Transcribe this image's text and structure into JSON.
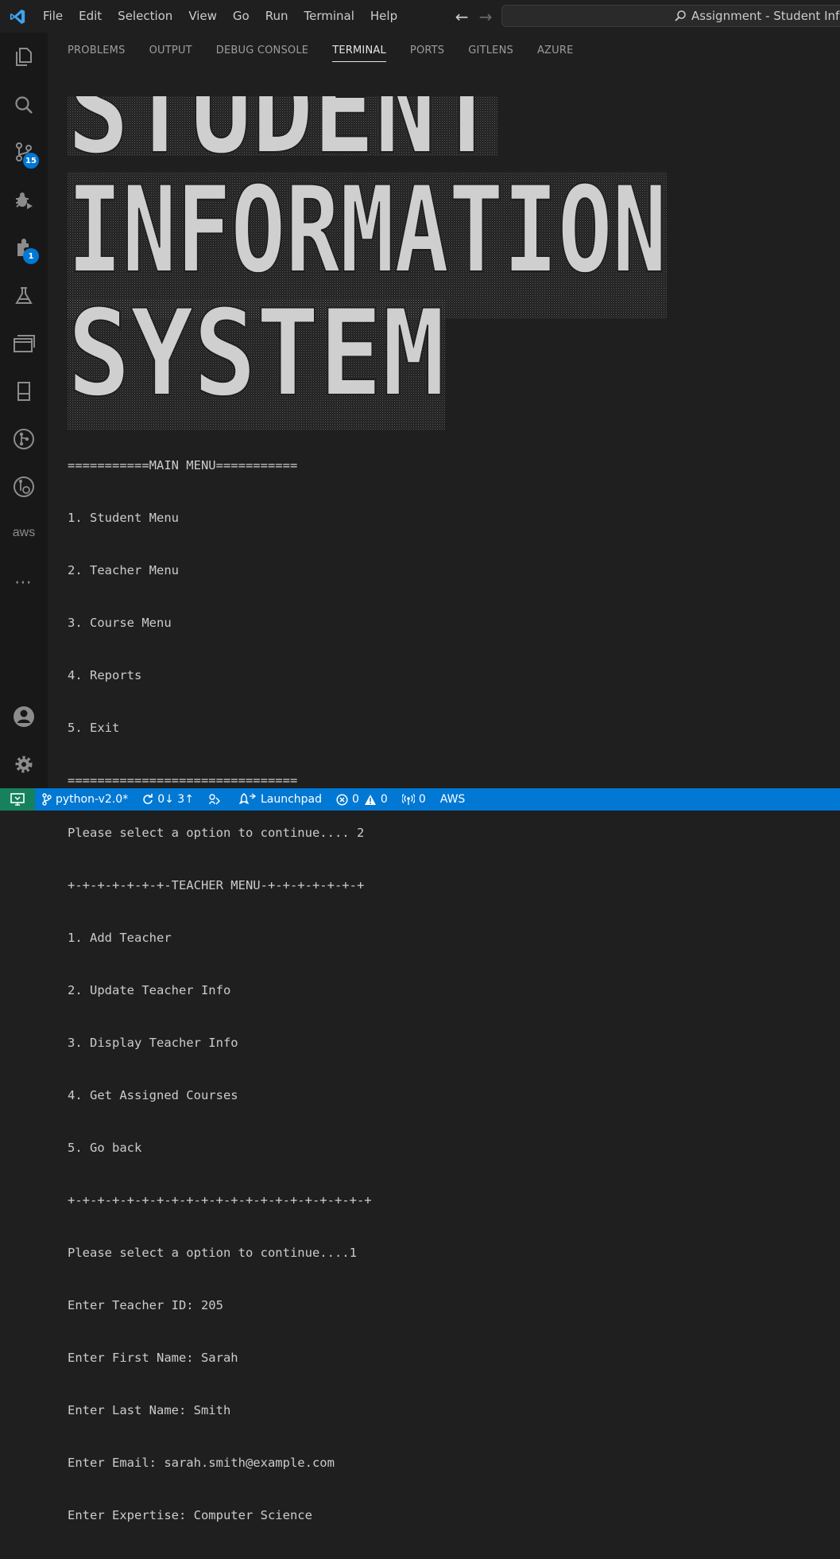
{
  "menu": [
    "File",
    "Edit",
    "Selection",
    "View",
    "Go",
    "Run",
    "Terminal",
    "Help"
  ],
  "search": {
    "text": "Assignment - Student Information System"
  },
  "activity": {
    "scm_badge": "15",
    "extensions_badge": "1",
    "aws_label": "aws"
  },
  "panel": {
    "tabs": [
      "PROBLEMS",
      "OUTPUT",
      "DEBUG CONSOLE",
      "TERMINAL",
      "PORTS",
      "GITLENS",
      "AZURE"
    ],
    "active_tab": "TERMINAL"
  },
  "banner": {
    "lines": [
      "STUDENT",
      "INFORMATION",
      "SYSTEM"
    ]
  },
  "terminal": {
    "lines": [
      "===========MAIN MENU===========",
      "1. Student Menu",
      "2. Teacher Menu",
      "3. Course Menu",
      "4. Reports",
      "5. Exit",
      "===============================",
      "Please select a option to continue.... 2",
      "+-+-+-+-+-+-+-TEACHER MENU-+-+-+-+-+-+-+",
      "1. Add Teacher",
      "2. Update Teacher Info",
      "3. Display Teacher Info",
      "4. Get Assigned Courses",
      "5. Go back",
      "+-+-+-+-+-+-+-+-+-+-+-+-+-+-+-+-+-+-+-+-+",
      "Please select a option to continue....1",
      "Enter Teacher ID: 205",
      "Enter First Name: Sarah",
      "Enter Last Name: Smith",
      "Enter Email: sarah.smith@example.com",
      "Enter Expertise: Computer Science"
    ]
  },
  "status": {
    "branch": "python-v2.0*",
    "sync": "0↓ 3↑",
    "launchpad": "Launchpad",
    "errors": "0",
    "warnings": "0",
    "ports": "0",
    "aws": "AWS"
  },
  "colors": {
    "accent": "#0078d4",
    "remote": "#16825d",
    "background": "#1f1f1f",
    "activitybar": "#181818"
  }
}
